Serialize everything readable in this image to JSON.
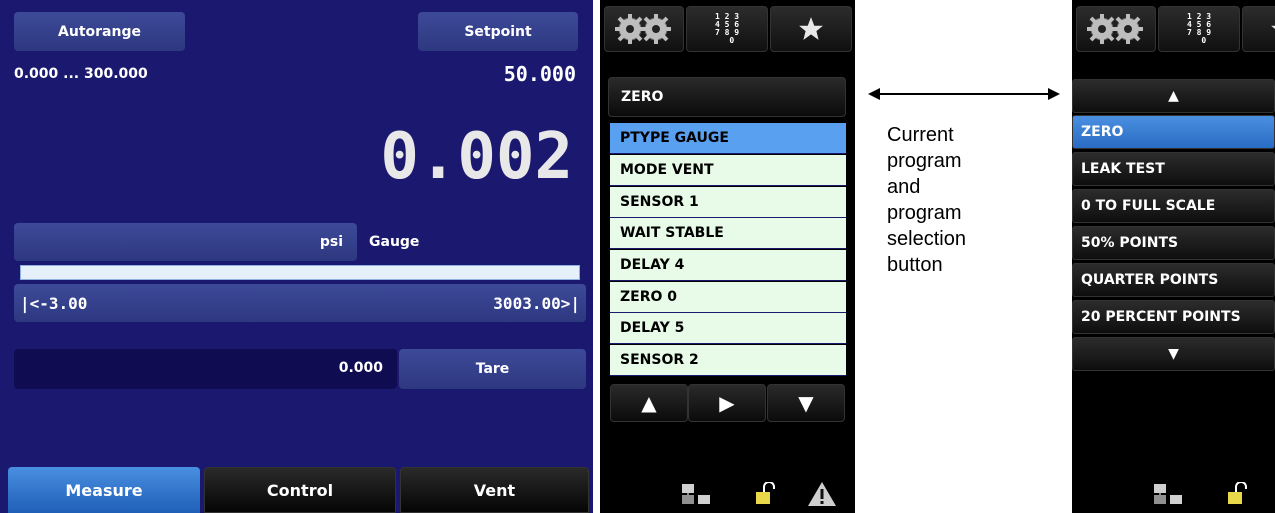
{
  "main": {
    "autorange_label": "Autorange",
    "setpoint_label": "Setpoint",
    "range_text": "0.000 ... 300.000",
    "setpoint_value": "50.000",
    "reading": "0.002",
    "unit": "psi",
    "pressure_type": "Gauge",
    "bar_min": "|<-3.00",
    "bar_max": "3003.00>|",
    "tare_value": "0.000",
    "tare_label": "Tare",
    "tabs": [
      "Measure",
      "Control",
      "Vent"
    ],
    "active_tab": "Measure"
  },
  "program_panel": {
    "icons": [
      "gears-icon",
      "keypad-icon",
      "star-icon"
    ],
    "keypad_glyph": "1 2 3\n4 5 6\n7 8 9\n  0",
    "current_program": "ZERO",
    "steps": [
      "PTYPE GAUGE",
      "MODE VENT",
      "SENSOR 1",
      "WAIT STABLE",
      "DELAY 4",
      "ZERO 0",
      "DELAY 5",
      "SENSOR 2"
    ],
    "selected_step": 0,
    "status_icons": [
      "network-icon",
      "lock-icon",
      "warning-icon"
    ]
  },
  "annotation": {
    "lines": [
      "Current",
      "program",
      "and",
      "program",
      "selection",
      "button"
    ]
  },
  "program_menu": {
    "items": [
      "ZERO",
      "LEAK TEST",
      "0 TO FULL SCALE",
      "50% POINTS",
      "QUARTER POINTS",
      "20 PERCENT POINTS"
    ],
    "selected_item": 0,
    "up_glyph": "▲",
    "down_glyph": "▼"
  },
  "colors": {
    "panel_blue": "#1b1870",
    "accent_blue": "#4a8fe0",
    "list_bg": "#e8fbe8"
  }
}
